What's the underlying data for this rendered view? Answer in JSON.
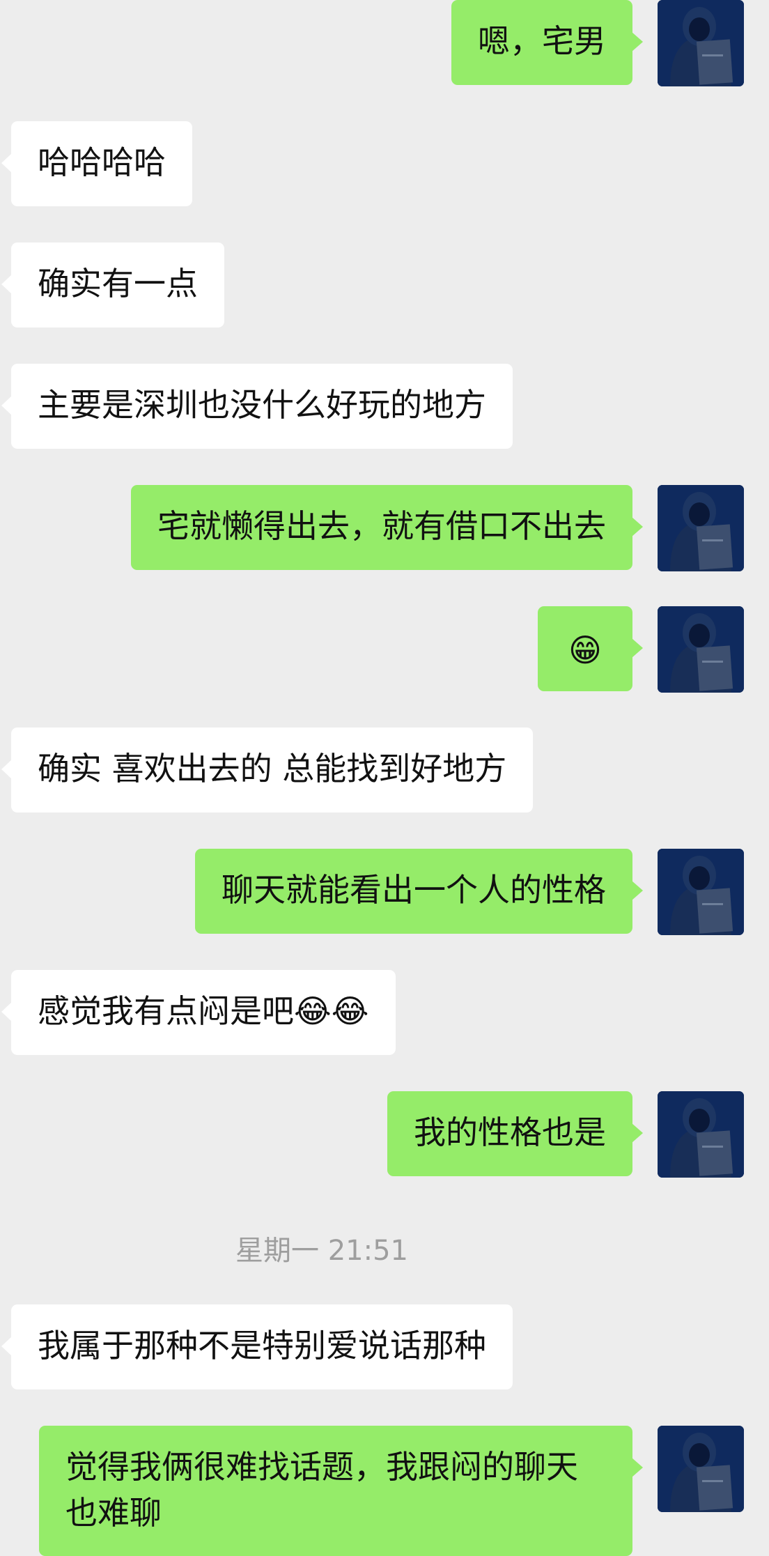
{
  "messages": [
    {
      "from": "me",
      "text": "嗯，宅男"
    },
    {
      "from": "other",
      "text": "哈哈哈哈"
    },
    {
      "from": "other",
      "text": "确实有一点"
    },
    {
      "from": "other",
      "text": "主要是深圳也没什么好玩的地方"
    },
    {
      "from": "me",
      "text": "宅就懒得出去，就有借口不出去"
    },
    {
      "from": "me",
      "text": "😁"
    },
    {
      "from": "other",
      "text": "确实 喜欢出去的 总能找到好地方"
    },
    {
      "from": "me",
      "text": "聊天就能看出一个人的性格"
    },
    {
      "from": "other",
      "text": "感觉我有点闷是吧😂😂"
    },
    {
      "from": "me",
      "text": "我的性格也是"
    },
    {
      "from": "other",
      "text": "我属于那种不是特别爱说话那种"
    },
    {
      "from": "me",
      "text": "觉得我俩很难找话题，我跟闷的聊天也难聊"
    }
  ],
  "timestamp": "星期一 21:51",
  "icons": {
    "avatar": "hooded-figure-reading-book-avatar",
    "grin": "grinning-face-emoji",
    "tears_of_joy": "face-with-tears-of-joy-emoji"
  },
  "colors": {
    "background": "#ededed",
    "outgoing_bubble": "#95ec69",
    "incoming_bubble": "#ffffff",
    "timestamp_text": "#9e9e9e"
  }
}
